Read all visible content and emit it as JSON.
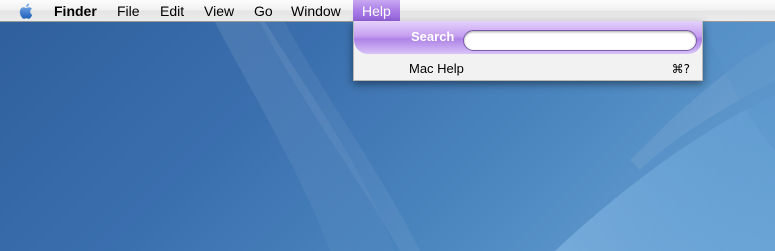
{
  "menubar": {
    "apple_icon": "apple-icon",
    "items": [
      {
        "label": "Finder",
        "bold": true
      },
      {
        "label": "File"
      },
      {
        "label": "Edit"
      },
      {
        "label": "View"
      },
      {
        "label": "Go"
      },
      {
        "label": "Window"
      },
      {
        "label": "Help",
        "active": true
      }
    ]
  },
  "help_menu": {
    "search_label": "Search",
    "search_value": "",
    "items": [
      {
        "label": "Mac Help",
        "shortcut": "⌘?"
      }
    ]
  },
  "colors": {
    "menu_highlight": "#9d6ce0",
    "desktop": "#3a6fae"
  }
}
